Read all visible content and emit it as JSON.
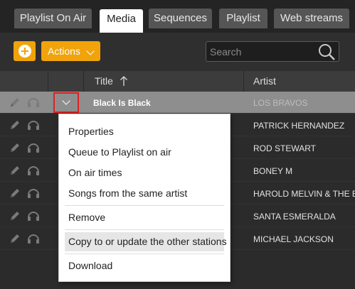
{
  "tabs": [
    {
      "label": "Playlist On Air"
    },
    {
      "label": "Media"
    },
    {
      "label": "Sequences"
    },
    {
      "label": "Playlist"
    },
    {
      "label": "Web streams"
    }
  ],
  "active_tab": "Media",
  "toolbar": {
    "add_icon": "plus-circle-icon",
    "actions_label": "Actions",
    "search_placeholder": "Search"
  },
  "table": {
    "columns": [
      "Title",
      "Artist"
    ],
    "sort": {
      "column": "Title",
      "direction": "ascending"
    },
    "rows": [
      {
        "title": "Black Is Black",
        "artist": "LOS BRAVOS",
        "selected": true
      },
      {
        "title": "",
        "artist": "PATRICK HERNANDEZ"
      },
      {
        "title": "",
        "artist": "ROD STEWART"
      },
      {
        "title": "",
        "artist": "BONEY M"
      },
      {
        "title": "",
        "artist": "HAROLD MELVIN & THE BLUE NOTES"
      },
      {
        "title": "",
        "artist": "SANTA ESMERALDA"
      },
      {
        "title": "",
        "artist": "MICHAEL JACKSON"
      }
    ]
  },
  "context_menu": {
    "items": [
      {
        "label": "Properties"
      },
      {
        "label": "Queue to Playlist on air"
      },
      {
        "label": "On air times"
      },
      {
        "label": "Songs from the same artist"
      },
      {
        "label": "Remove"
      },
      {
        "label": "Copy to or update the other stations",
        "highlighted": true
      },
      {
        "label": "Download"
      }
    ]
  },
  "colors": {
    "accent": "#f0a30a",
    "highlight_border": "#e02020",
    "selected_row": "#8e8e8e"
  }
}
